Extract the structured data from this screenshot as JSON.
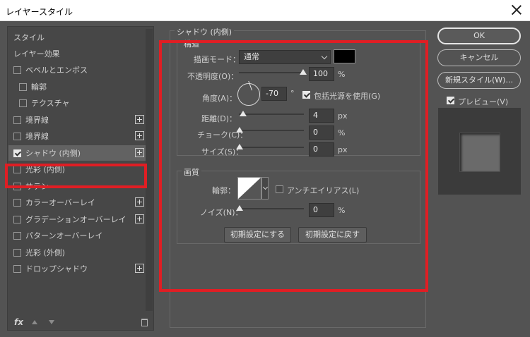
{
  "window": {
    "title": "レイヤースタイル"
  },
  "left": {
    "header_items": [
      "スタイル",
      "レイヤー効果"
    ],
    "items": [
      {
        "label": "ベベルとエンボス",
        "checked": false,
        "plus": false
      },
      {
        "label": "輪郭",
        "checked": false,
        "plus": false
      },
      {
        "label": "テクスチャ",
        "checked": false,
        "plus": false
      },
      {
        "label": "境界線",
        "checked": false,
        "plus": true
      },
      {
        "label": "境界線",
        "checked": false,
        "plus": true
      },
      {
        "label": "シャドウ (内側)",
        "checked": true,
        "plus": true
      },
      {
        "label": "光彩 (内側)",
        "checked": false,
        "plus": false
      },
      {
        "label": "サテン",
        "checked": false,
        "plus": false
      },
      {
        "label": "カラーオーバーレイ",
        "checked": false,
        "plus": true
      },
      {
        "label": "グラデーションオーバーレイ",
        "checked": false,
        "plus": true
      },
      {
        "label": "パターンオーバーレイ",
        "checked": false,
        "plus": false
      },
      {
        "label": "光彩 (外側)",
        "checked": false,
        "plus": false
      },
      {
        "label": "ドロップシャドウ",
        "checked": false,
        "plus": true
      }
    ],
    "footer": {
      "fx": "fx"
    }
  },
  "panel": {
    "title": "シャドウ (内側)",
    "structure": {
      "label": "構造",
      "blend_mode_label": "描画モード：",
      "blend_mode_value": "通常",
      "opacity_label": "不透明度(O)：",
      "opacity_value": "100",
      "opacity_unit": "%",
      "angle_label": "角度(A)：",
      "angle_value": "-70",
      "angle_unit": "°",
      "global_light_label": "包括光源を使用(G)",
      "distance_label": "距離(D)：",
      "distance_value": "4",
      "distance_unit": "px",
      "choke_label": "チョーク(C)：",
      "choke_value": "0",
      "choke_unit": "%",
      "size_label": "サイズ(S)：",
      "size_value": "0",
      "size_unit": "px"
    },
    "quality": {
      "label": "画質",
      "contour_label": "輪郭：",
      "antialias_label": "アンチエイリアス(L)",
      "noise_label": "ノイズ(N)：",
      "noise_value": "0",
      "noise_unit": "%"
    },
    "buttons": {
      "make_default": "初期設定にする",
      "reset_default": "初期設定に戻す"
    }
  },
  "right": {
    "ok": "OK",
    "cancel": "キャンセル",
    "new_style": "新規スタイル(W)...",
    "preview_label": "プレビュー(V)"
  }
}
